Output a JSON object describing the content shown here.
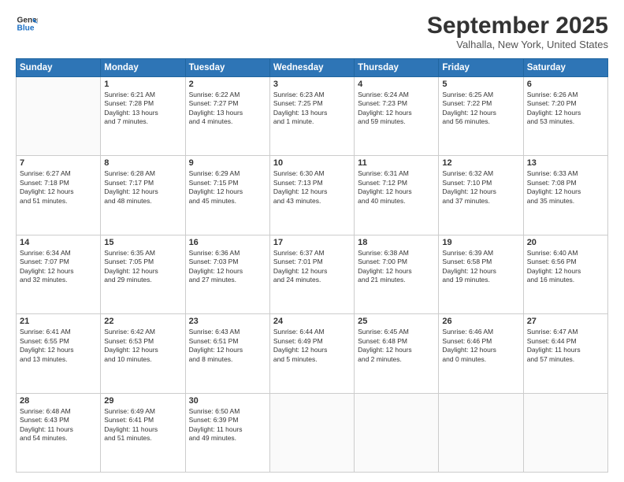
{
  "header": {
    "logo_line1": "General",
    "logo_line2": "Blue",
    "month": "September 2025",
    "location": "Valhalla, New York, United States"
  },
  "weekdays": [
    "Sunday",
    "Monday",
    "Tuesday",
    "Wednesday",
    "Thursday",
    "Friday",
    "Saturday"
  ],
  "weeks": [
    [
      {
        "day": "",
        "info": ""
      },
      {
        "day": "1",
        "info": "Sunrise: 6:21 AM\nSunset: 7:28 PM\nDaylight: 13 hours\nand 7 minutes."
      },
      {
        "day": "2",
        "info": "Sunrise: 6:22 AM\nSunset: 7:27 PM\nDaylight: 13 hours\nand 4 minutes."
      },
      {
        "day": "3",
        "info": "Sunrise: 6:23 AM\nSunset: 7:25 PM\nDaylight: 13 hours\nand 1 minute."
      },
      {
        "day": "4",
        "info": "Sunrise: 6:24 AM\nSunset: 7:23 PM\nDaylight: 12 hours\nand 59 minutes."
      },
      {
        "day": "5",
        "info": "Sunrise: 6:25 AM\nSunset: 7:22 PM\nDaylight: 12 hours\nand 56 minutes."
      },
      {
        "day": "6",
        "info": "Sunrise: 6:26 AM\nSunset: 7:20 PM\nDaylight: 12 hours\nand 53 minutes."
      }
    ],
    [
      {
        "day": "7",
        "info": "Sunrise: 6:27 AM\nSunset: 7:18 PM\nDaylight: 12 hours\nand 51 minutes."
      },
      {
        "day": "8",
        "info": "Sunrise: 6:28 AM\nSunset: 7:17 PM\nDaylight: 12 hours\nand 48 minutes."
      },
      {
        "day": "9",
        "info": "Sunrise: 6:29 AM\nSunset: 7:15 PM\nDaylight: 12 hours\nand 45 minutes."
      },
      {
        "day": "10",
        "info": "Sunrise: 6:30 AM\nSunset: 7:13 PM\nDaylight: 12 hours\nand 43 minutes."
      },
      {
        "day": "11",
        "info": "Sunrise: 6:31 AM\nSunset: 7:12 PM\nDaylight: 12 hours\nand 40 minutes."
      },
      {
        "day": "12",
        "info": "Sunrise: 6:32 AM\nSunset: 7:10 PM\nDaylight: 12 hours\nand 37 minutes."
      },
      {
        "day": "13",
        "info": "Sunrise: 6:33 AM\nSunset: 7:08 PM\nDaylight: 12 hours\nand 35 minutes."
      }
    ],
    [
      {
        "day": "14",
        "info": "Sunrise: 6:34 AM\nSunset: 7:07 PM\nDaylight: 12 hours\nand 32 minutes."
      },
      {
        "day": "15",
        "info": "Sunrise: 6:35 AM\nSunset: 7:05 PM\nDaylight: 12 hours\nand 29 minutes."
      },
      {
        "day": "16",
        "info": "Sunrise: 6:36 AM\nSunset: 7:03 PM\nDaylight: 12 hours\nand 27 minutes."
      },
      {
        "day": "17",
        "info": "Sunrise: 6:37 AM\nSunset: 7:01 PM\nDaylight: 12 hours\nand 24 minutes."
      },
      {
        "day": "18",
        "info": "Sunrise: 6:38 AM\nSunset: 7:00 PM\nDaylight: 12 hours\nand 21 minutes."
      },
      {
        "day": "19",
        "info": "Sunrise: 6:39 AM\nSunset: 6:58 PM\nDaylight: 12 hours\nand 19 minutes."
      },
      {
        "day": "20",
        "info": "Sunrise: 6:40 AM\nSunset: 6:56 PM\nDaylight: 12 hours\nand 16 minutes."
      }
    ],
    [
      {
        "day": "21",
        "info": "Sunrise: 6:41 AM\nSunset: 6:55 PM\nDaylight: 12 hours\nand 13 minutes."
      },
      {
        "day": "22",
        "info": "Sunrise: 6:42 AM\nSunset: 6:53 PM\nDaylight: 12 hours\nand 10 minutes."
      },
      {
        "day": "23",
        "info": "Sunrise: 6:43 AM\nSunset: 6:51 PM\nDaylight: 12 hours\nand 8 minutes."
      },
      {
        "day": "24",
        "info": "Sunrise: 6:44 AM\nSunset: 6:49 PM\nDaylight: 12 hours\nand 5 minutes."
      },
      {
        "day": "25",
        "info": "Sunrise: 6:45 AM\nSunset: 6:48 PM\nDaylight: 12 hours\nand 2 minutes."
      },
      {
        "day": "26",
        "info": "Sunrise: 6:46 AM\nSunset: 6:46 PM\nDaylight: 12 hours\nand 0 minutes."
      },
      {
        "day": "27",
        "info": "Sunrise: 6:47 AM\nSunset: 6:44 PM\nDaylight: 11 hours\nand 57 minutes."
      }
    ],
    [
      {
        "day": "28",
        "info": "Sunrise: 6:48 AM\nSunset: 6:43 PM\nDaylight: 11 hours\nand 54 minutes."
      },
      {
        "day": "29",
        "info": "Sunrise: 6:49 AM\nSunset: 6:41 PM\nDaylight: 11 hours\nand 51 minutes."
      },
      {
        "day": "30",
        "info": "Sunrise: 6:50 AM\nSunset: 6:39 PM\nDaylight: 11 hours\nand 49 minutes."
      },
      {
        "day": "",
        "info": ""
      },
      {
        "day": "",
        "info": ""
      },
      {
        "day": "",
        "info": ""
      },
      {
        "day": "",
        "info": ""
      }
    ]
  ]
}
